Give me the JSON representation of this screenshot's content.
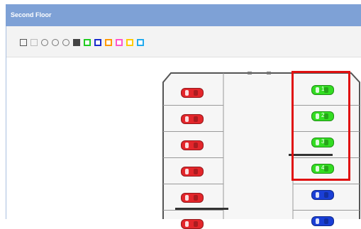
{
  "window": {
    "title": "Second Floor"
  },
  "toolbar": {
    "buttons": [
      {
        "name": "edit-icon",
        "color": "#555555"
      },
      {
        "name": "select-icon",
        "color": "#bbbbbb"
      },
      {
        "name": "zoom-in-icon",
        "color": "#777777"
      },
      {
        "name": "zoom-out-icon",
        "color": "#777777"
      },
      {
        "name": "zoom-reset-icon",
        "color": "#777777"
      },
      {
        "name": "note-icon",
        "color": "#444444"
      },
      {
        "name": "flag-green-icon",
        "color": "#22cc22"
      },
      {
        "name": "flag-blue-icon",
        "color": "#1a2bcc"
      },
      {
        "name": "flag-orange-icon",
        "color": "#ff9900"
      },
      {
        "name": "flag-pink-icon",
        "color": "#ff55cc"
      },
      {
        "name": "flag-yellow-icon",
        "color": "#ffcc00"
      },
      {
        "name": "flag-cyan-icon",
        "color": "#22aaee"
      }
    ]
  },
  "floor_map": {
    "left_column_cars": [
      "red",
      "red",
      "red",
      "red",
      "red",
      "red"
    ],
    "right_column_cars": [
      {
        "color": "green",
        "label": "1"
      },
      {
        "color": "green",
        "label": "2"
      },
      {
        "color": "green",
        "label": "3"
      },
      {
        "color": "green",
        "label": "4"
      },
      {
        "color": "blue",
        "label": ""
      },
      {
        "color": "blue",
        "label": ""
      }
    ],
    "highlight_color": "#e01010"
  },
  "colors": {
    "red": "#e3262b",
    "green": "#33dd22",
    "blue": "#1a3fd6"
  }
}
